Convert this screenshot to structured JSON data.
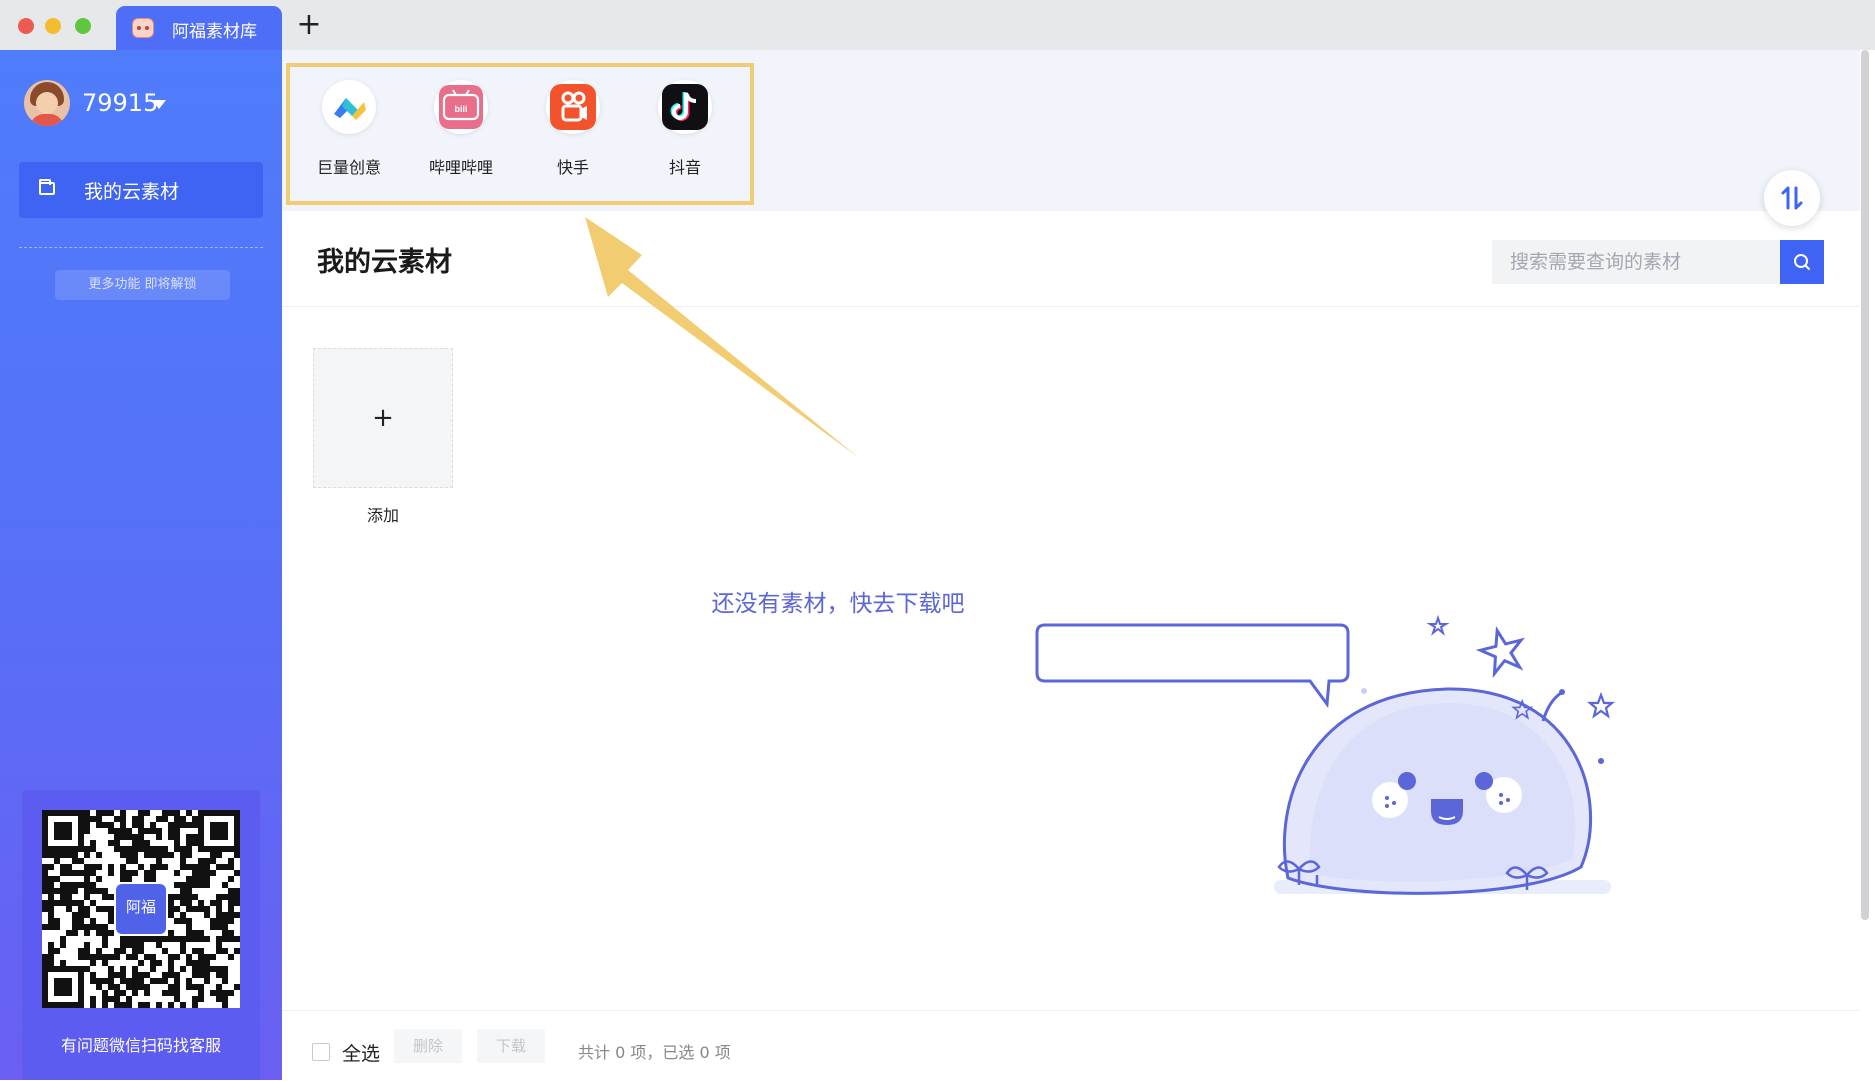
{
  "window": {
    "tab_title": "阿福素材库",
    "new_tab_symbol": "+"
  },
  "sidebar": {
    "username": "79915",
    "nav_item": "我的云素材",
    "unlock_text": "更多功能 即将解锁",
    "qr_caption": "有问题微信扫码找客服",
    "qr_logo_text": "阿福"
  },
  "platforms": [
    {
      "label": "巨量创意",
      "icon": "juliang-icon"
    },
    {
      "label": "哔哩哔哩",
      "icon": "bilibili-icon"
    },
    {
      "label": "快手",
      "icon": "kuaishou-icon"
    },
    {
      "label": "抖音",
      "icon": "douyin-icon"
    }
  ],
  "main": {
    "title": "我的云素材",
    "search_placeholder": "搜索需要查询的素材",
    "add_symbol": "+",
    "add_label": "添加",
    "empty_text": "还没有素材，快去下载吧"
  },
  "footer": {
    "select_all": "全选",
    "delete": "删除",
    "download": "下载",
    "stats": "共计 0 项，已选 0 项"
  },
  "colors": {
    "accent": "#3e63f5",
    "sidebar_top": "#4f7cfa",
    "sidebar_bottom": "#6a5ff1",
    "highlight": "#f0cc74",
    "kuaishou": "#f2532c",
    "bilibili": "#e86e8a"
  }
}
